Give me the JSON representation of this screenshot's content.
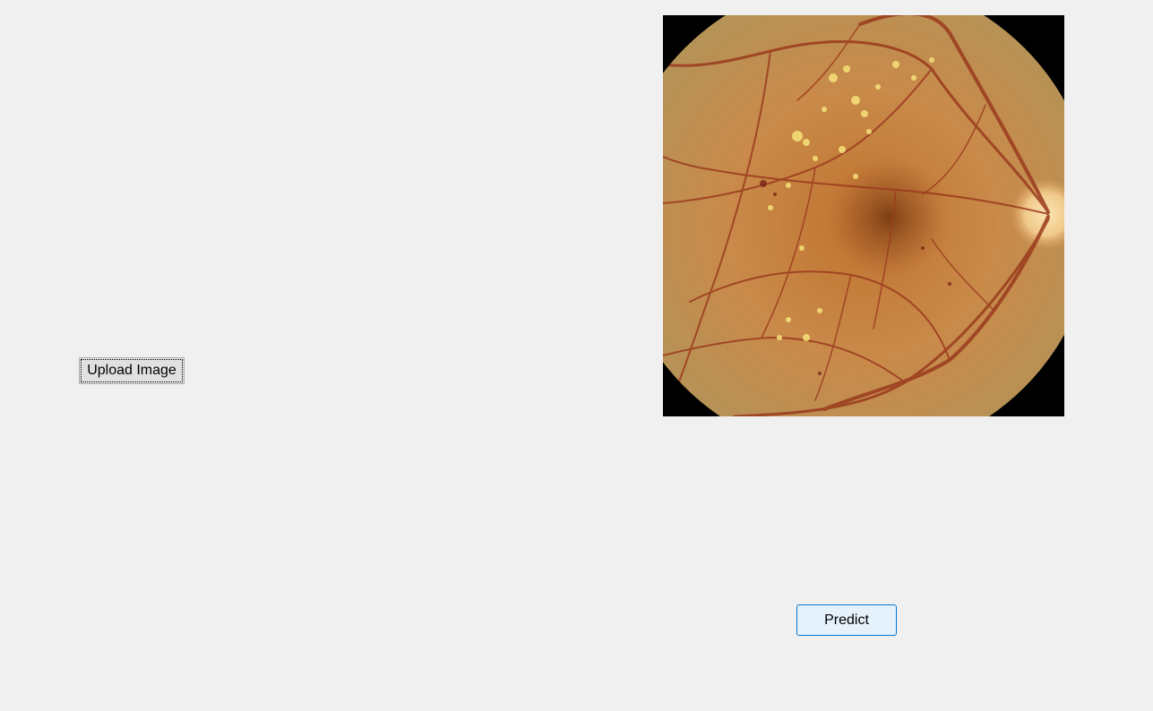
{
  "window": {
    "background": "#f0f0f0"
  },
  "controls": {
    "upload_label": "Upload Image",
    "predict_label": "Predict"
  },
  "image_panel": {
    "content": "retina-fundus-image",
    "colors": {
      "fundus_base": "#c98a4a",
      "fundus_edge": "#b5894f",
      "macula": "#8a4a1a",
      "optic_disc": "#f2d29a",
      "vessel": "#9a3a1e",
      "exudate": "#f6e27a",
      "background": "#000000"
    }
  }
}
